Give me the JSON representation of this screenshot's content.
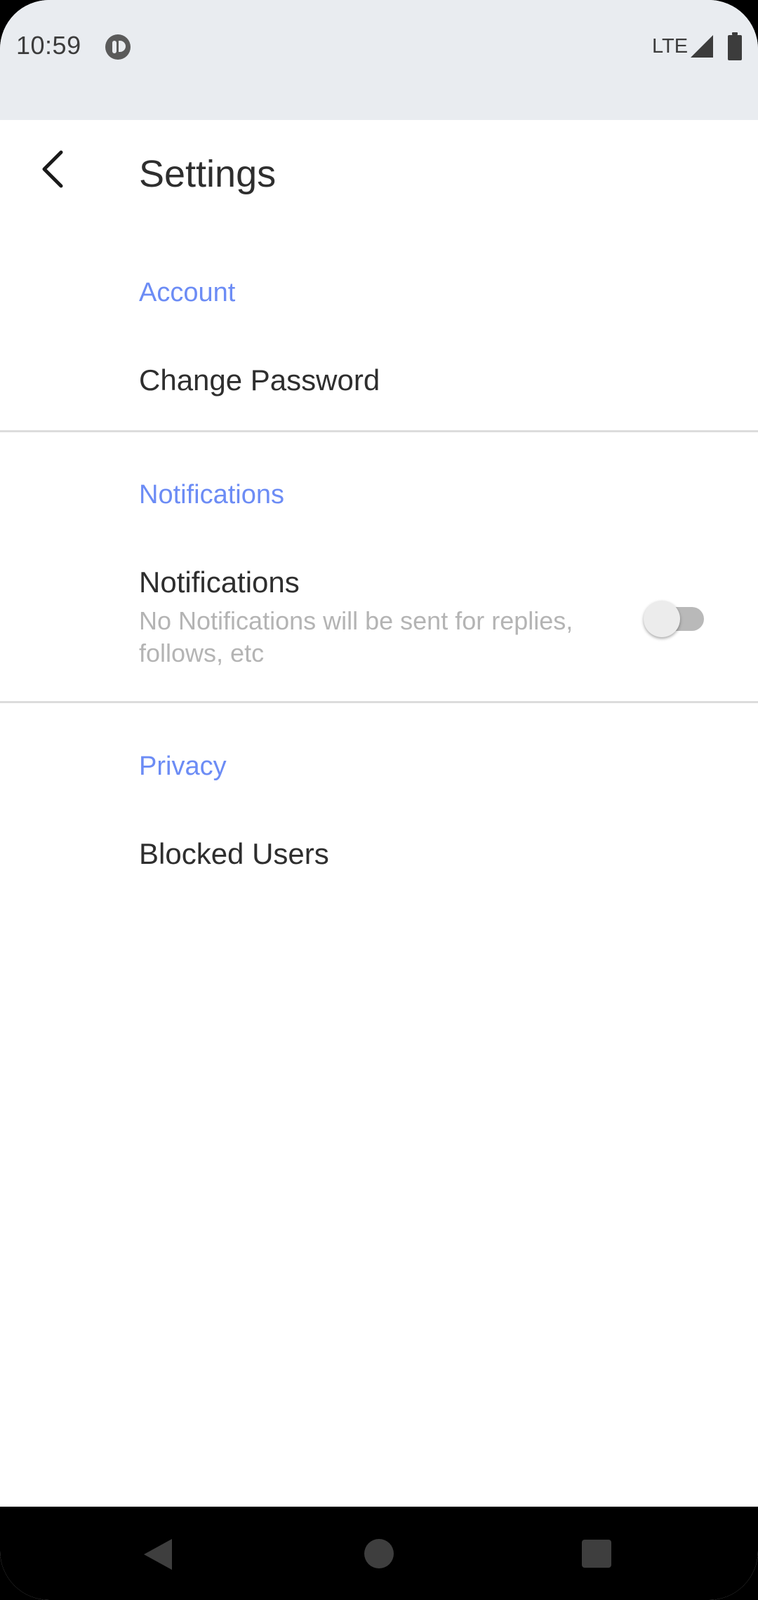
{
  "status_bar": {
    "time": "10:59",
    "network": "LTE",
    "app_icon": "app-notification-icon",
    "signal_icon": "signal-icon",
    "battery_icon": "battery-icon"
  },
  "app_bar": {
    "title": "Settings",
    "back_icon": "back-arrow-icon"
  },
  "sections": {
    "account": {
      "header": "Account",
      "change_password": "Change Password"
    },
    "notifications": {
      "header": "Notifications",
      "title": "Notifications",
      "summary": "No Notifications will be sent for replies, follows, etc",
      "enabled": false
    },
    "privacy": {
      "header": "Privacy",
      "blocked_users": "Blocked Users"
    }
  },
  "nav_bar": {
    "back_icon": "nav-back-icon",
    "home_icon": "nav-home-icon",
    "recents_icon": "nav-recents-icon"
  },
  "colors": {
    "accent": "#6c8cf5",
    "status_bar_bg": "#e9ecf0",
    "text_primary": "#2e2e2e",
    "text_secondary": "#b4b4b4",
    "divider": "#dcdcdc"
  }
}
